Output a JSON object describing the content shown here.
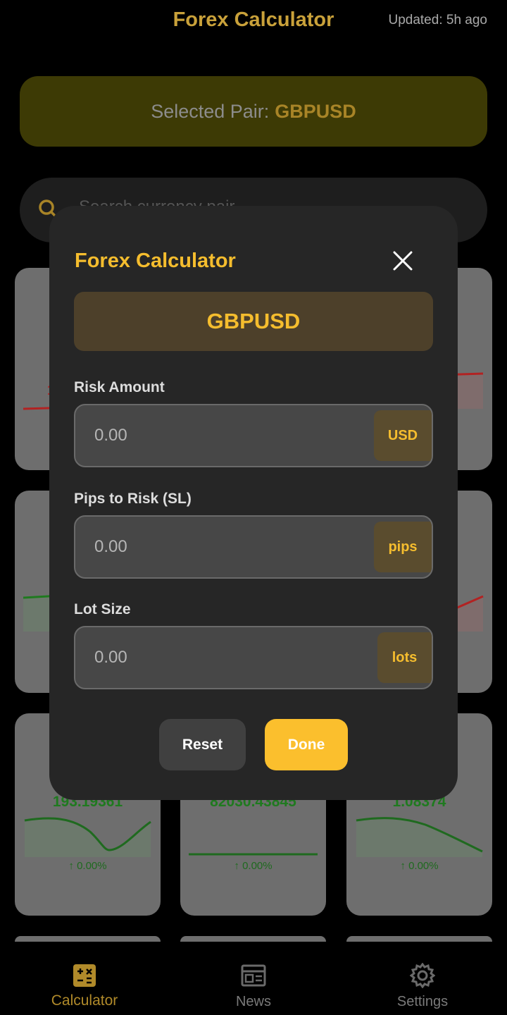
{
  "header": {
    "title": "Forex Calculator",
    "updated": "Updated: 5h ago"
  },
  "selected_pair": {
    "label": "Selected Pair:",
    "code": "GBPUSD"
  },
  "search": {
    "placeholder": "Search currency pair"
  },
  "cards": [
    {
      "price": "193.19361",
      "change": "0.00%"
    },
    {
      "price": "82030.43845",
      "change": "0.00%"
    },
    {
      "price": "1.08374",
      "change": "0.00%"
    }
  ],
  "modal": {
    "title": "Forex Calculator",
    "pair": "GBPUSD",
    "fields": [
      {
        "label": "Risk Amount",
        "placeholder": "0.00",
        "unit": "USD"
      },
      {
        "label": "Pips to Risk (SL)",
        "placeholder": "0.00",
        "unit": "pips"
      },
      {
        "label": "Lot Size",
        "placeholder": "0.00",
        "unit": "lots"
      }
    ],
    "reset_label": "Reset",
    "done_label": "Done"
  },
  "nav": {
    "items": [
      {
        "label": "Calculator",
        "icon": "calculator-icon",
        "active": true
      },
      {
        "label": "News",
        "icon": "news-icon",
        "active": false
      },
      {
        "label": "Settings",
        "icon": "settings-icon",
        "active": false
      }
    ]
  },
  "colors": {
    "accent": "#f5bd2e",
    "done_button": "#fbbf2d",
    "modal_bg": "#262626",
    "positive": "#1f7a1f",
    "negative": "#b22222"
  }
}
